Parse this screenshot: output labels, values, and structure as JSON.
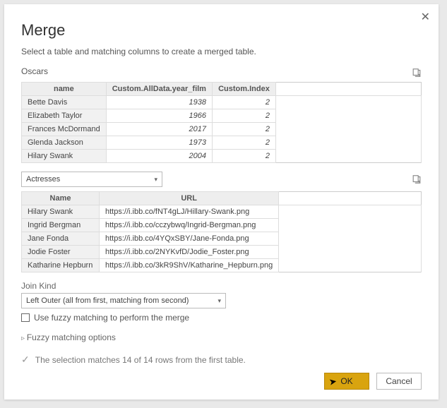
{
  "dialog": {
    "title": "Merge",
    "subtitle": "Select a table and matching columns to create a merged table."
  },
  "table1": {
    "label": "Oscars",
    "columns": [
      "name",
      "Custom.AllData.year_film",
      "Custom.Index"
    ],
    "rows": [
      {
        "name": "Bette Davis",
        "year": "1938",
        "idx": "2"
      },
      {
        "name": "Elizabeth Taylor",
        "year": "1966",
        "idx": "2"
      },
      {
        "name": "Frances McDormand",
        "year": "2017",
        "idx": "2"
      },
      {
        "name": "Glenda Jackson",
        "year": "1973",
        "idx": "2"
      },
      {
        "name": "Hilary Swank",
        "year": "2004",
        "idx": "2"
      }
    ]
  },
  "table2": {
    "select_label": "Actresses",
    "columns": [
      "Name",
      "URL"
    ],
    "rows": [
      {
        "name": "Hilary Swank",
        "url": "https://i.ibb.co/fNT4gLJ/Hillary-Swank.png"
      },
      {
        "name": "Ingrid Bergman",
        "url": "https://i.ibb.co/cczybwq/Ingrid-Bergman.png"
      },
      {
        "name": "Jane Fonda",
        "url": "https://i.ibb.co/4YQxSBY/Jane-Fonda.png"
      },
      {
        "name": "Jodie Foster",
        "url": "https://i.ibb.co/2NYKvfD/Jodie_Foster.png"
      },
      {
        "name": "Katharine Hepburn",
        "url": "https://i.ibb.co/3kR9ShV/Katharine_Hepburn.png"
      }
    ]
  },
  "join": {
    "label": "Join Kind",
    "value": "Left Outer (all from first, matching from second)"
  },
  "fuzzy": {
    "checkbox_label": "Use fuzzy matching to perform the merge",
    "expander_label": "Fuzzy matching options"
  },
  "status": "The selection matches 14 of 14 rows from the first table.",
  "buttons": {
    "ok": "OK",
    "cancel": "Cancel"
  }
}
